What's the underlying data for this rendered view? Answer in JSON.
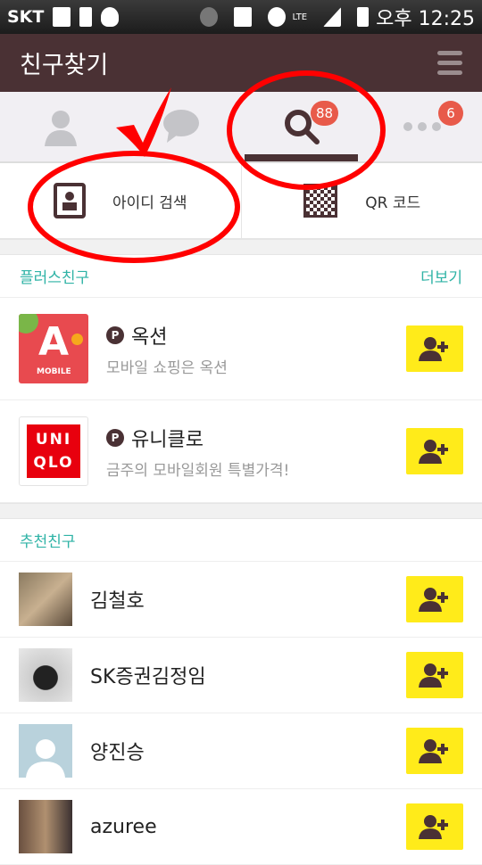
{
  "status_bar": {
    "carrier": "SKT",
    "network": "LTE",
    "time": "오후 12:25"
  },
  "header": {
    "title": "친구찾기"
  },
  "tabs": [
    {
      "name": "friends",
      "icon": "person-icon"
    },
    {
      "name": "chats",
      "icon": "chat-bubble-icon"
    },
    {
      "name": "find",
      "icon": "search-icon",
      "badge": "88",
      "active": true
    },
    {
      "name": "more",
      "icon": "more-icon",
      "badge": "6"
    }
  ],
  "options": {
    "id_search": "아이디 검색",
    "qr_code": "QR 코드"
  },
  "plus_friends": {
    "title": "플러스친구",
    "more": "더보기",
    "items": [
      {
        "name": "옥션",
        "desc": "모바일 쇼핑은 옥션",
        "logo_text": "A MOBILE"
      },
      {
        "name": "유니클로",
        "desc": "금주의 모바일회원 특별가격!",
        "logo_text": "UNI QLO"
      }
    ]
  },
  "recommended": {
    "title": "추천친구",
    "items": [
      {
        "name": "김철호"
      },
      {
        "name": "SK증권김정임"
      },
      {
        "name": "양진승"
      },
      {
        "name": "azuree"
      }
    ]
  },
  "colors": {
    "header": "#4a3134",
    "accent": "#2fb3a6",
    "add_button": "#ffeb1a",
    "badge": "#e85a4a",
    "annotation": "#ff0000"
  }
}
